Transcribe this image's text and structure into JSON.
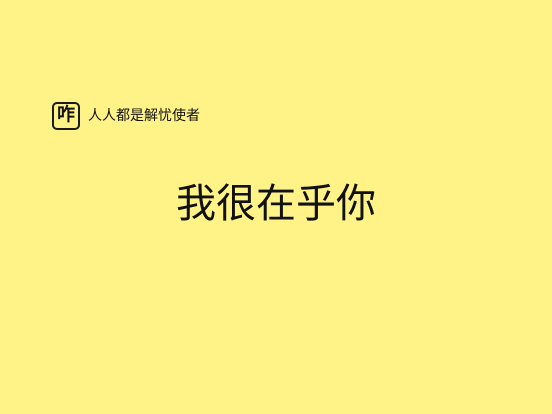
{
  "brand": {
    "logo_text": "咋",
    "name": "人人都是解忧使者"
  },
  "main": {
    "headline": "我很在乎你"
  },
  "colors": {
    "background": "#fff287",
    "text": "#111111",
    "logo_border": "#1b1b1b"
  }
}
